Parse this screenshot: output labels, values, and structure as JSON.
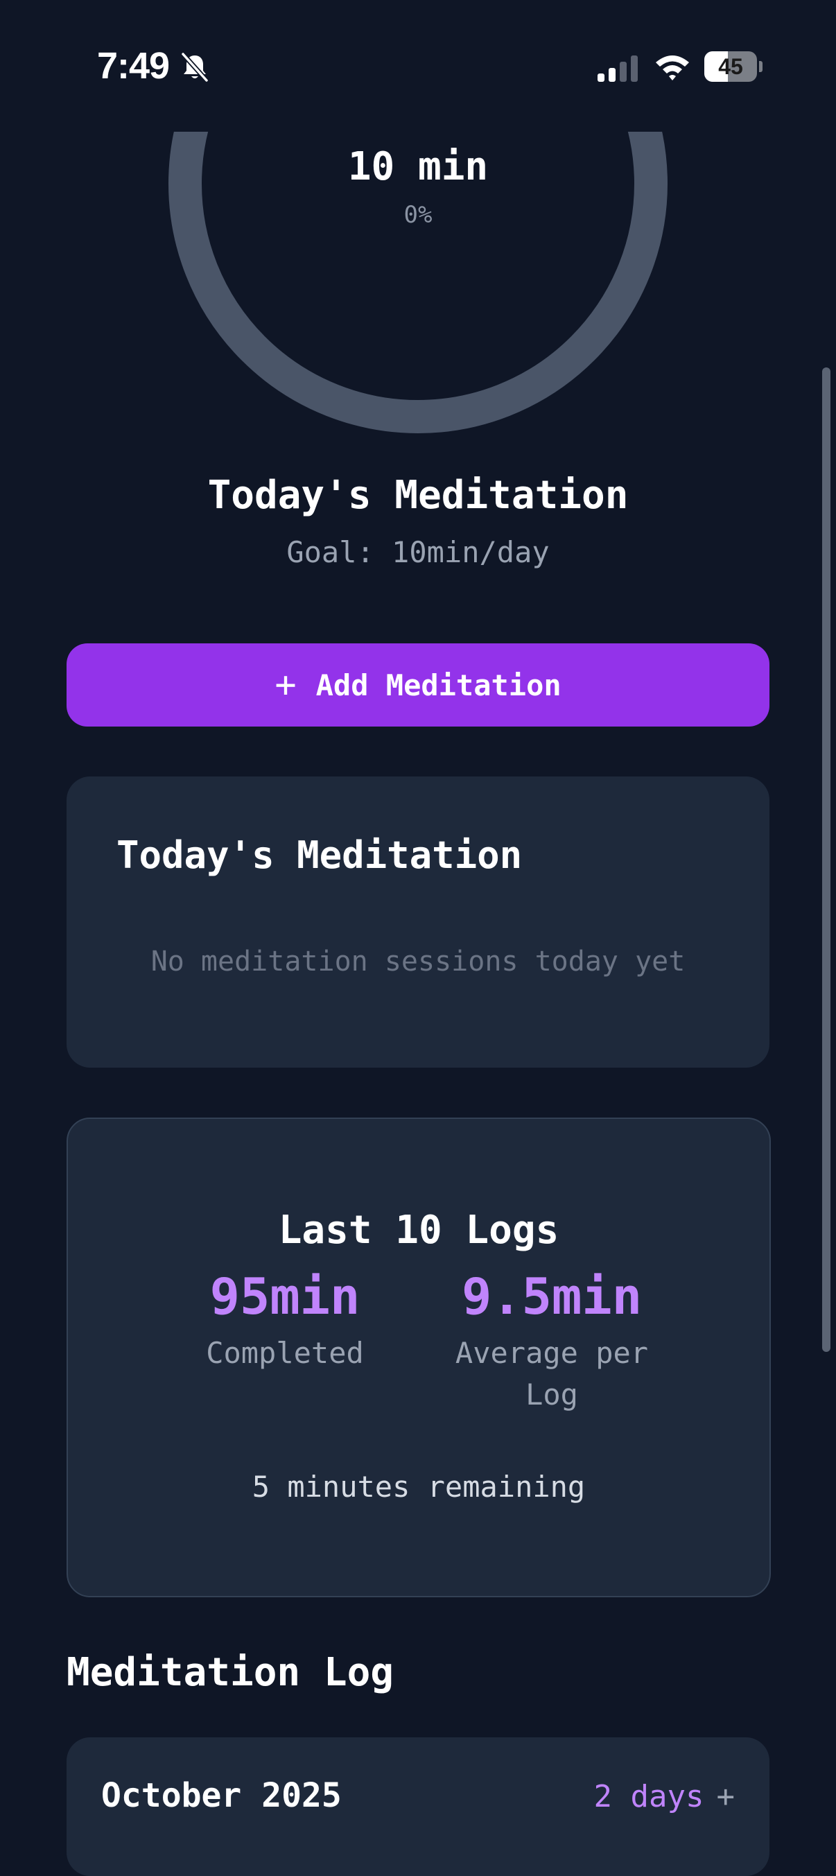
{
  "status_bar": {
    "time": "7:49",
    "battery": "45",
    "battery_level": 0.45,
    "icons": [
      "bell-slash-icon",
      "cellular-signal-icon",
      "wifi-icon",
      "battery-icon"
    ]
  },
  "progress": {
    "value": "10 min",
    "percent": "0%",
    "fraction": 0,
    "track_color": "#4a5568"
  },
  "today": {
    "title": "Today's Meditation",
    "goal": "Goal: 10min/day"
  },
  "add_button": {
    "icon": "plus-icon",
    "label": "Add Meditation",
    "color": "#9333ea"
  },
  "today_card": {
    "title": "Today's Meditation",
    "empty_message": "No meditation sessions today yet"
  },
  "stats_card": {
    "title": "Last 10 Logs",
    "completed_value": "95min",
    "completed_label": "Completed",
    "average_value": "9.5min",
    "average_label": "Average per Log",
    "remaining": "5 minutes remaining",
    "accent": "#c084fc"
  },
  "log": {
    "heading": "Meditation Log",
    "months": [
      {
        "label": "October 2025",
        "days": "2 days",
        "toggle": "+"
      }
    ]
  },
  "colors": {
    "background": "#0f1626",
    "card": "#1e293b"
  }
}
